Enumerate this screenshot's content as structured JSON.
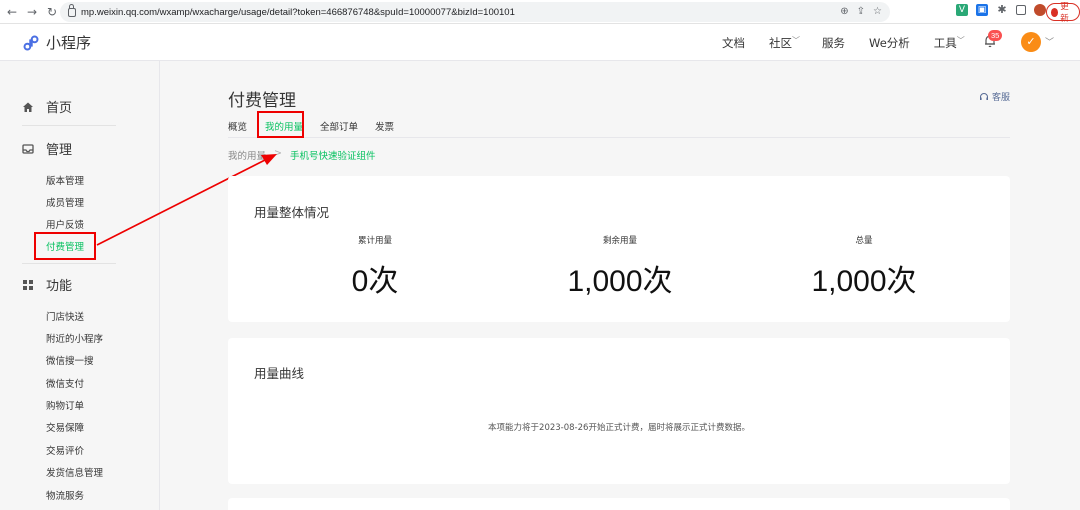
{
  "browser": {
    "url": "mp.weixin.qq.com/wxamp/wxacharge/usage/detail?token=466876748&spuId=10000077&bizId=100101",
    "update_label": "更新"
  },
  "header": {
    "app_name": "小程序",
    "nav": [
      {
        "label": "文档"
      },
      {
        "label": "社区"
      },
      {
        "label": "服务"
      },
      {
        "label": "We分析"
      },
      {
        "label": "工具"
      }
    ],
    "notification_count": "35"
  },
  "sidebar": {
    "groups": [
      {
        "label": "首页",
        "icon": "home-icon"
      },
      {
        "label": "管理",
        "icon": "inbox-icon"
      },
      {
        "label": "功能",
        "icon": "grid-icon"
      }
    ],
    "manage_items": [
      {
        "label": "版本管理"
      },
      {
        "label": "成员管理"
      },
      {
        "label": "用户反馈"
      },
      {
        "label": "付费管理"
      }
    ],
    "feature_items": [
      {
        "label": "门店快送"
      },
      {
        "label": "附近的小程序"
      },
      {
        "label": "微信搜一搜"
      },
      {
        "label": "微信支付"
      },
      {
        "label": "购物订单"
      },
      {
        "label": "交易保障"
      },
      {
        "label": "交易评价"
      },
      {
        "label": "发货信息管理"
      },
      {
        "label": "物流服务"
      }
    ]
  },
  "page": {
    "title": "付费管理",
    "service_label": "客服",
    "tabs": [
      {
        "label": "概览"
      },
      {
        "label": "我的用量"
      },
      {
        "label": "全部订单"
      },
      {
        "label": "发票"
      }
    ],
    "breadcrumb": {
      "parent": "我的用量",
      "separator": ">",
      "current": "手机号快速验证组件"
    }
  },
  "usage_overview": {
    "title": "用量整体情况",
    "stats": [
      {
        "label": "累计用量",
        "value": "0次"
      },
      {
        "label": "剩余用量",
        "value": "1,000次"
      },
      {
        "label": "总量",
        "value": "1,000次"
      }
    ]
  },
  "usage_curve": {
    "title": "用量曲线",
    "notice": "本项能力将于2023-08-26开始正式计费，届时将展示正式计费数据。"
  },
  "colors": {
    "accent": "#07c160",
    "highlight": "#e00000",
    "link": "#576b95"
  }
}
